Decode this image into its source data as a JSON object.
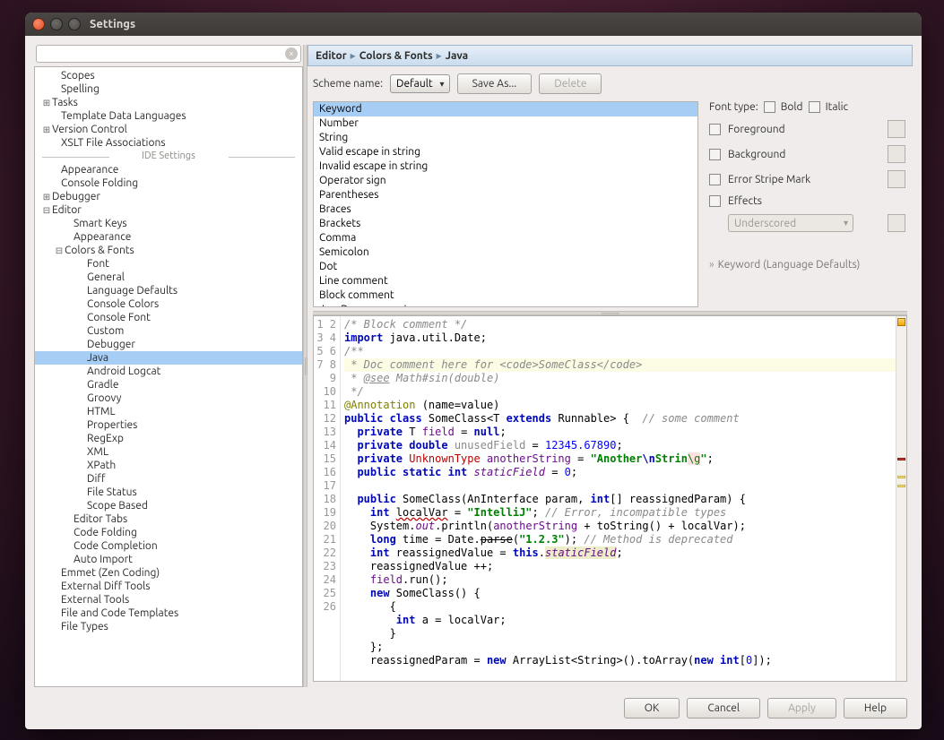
{
  "titlebar": {
    "title": "Settings"
  },
  "search": {
    "placeholder": ""
  },
  "tree_top": [
    {
      "lbl": "Scopes",
      "indent": 18,
      "exp": ""
    },
    {
      "lbl": "Spelling",
      "indent": 18,
      "exp": ""
    },
    {
      "lbl": "Tasks",
      "indent": 8,
      "exp": "⊞"
    },
    {
      "lbl": "Template Data Languages",
      "indent": 18,
      "exp": ""
    },
    {
      "lbl": "Version Control",
      "indent": 8,
      "exp": "⊞"
    },
    {
      "lbl": "XSLT File Associations",
      "indent": 18,
      "exp": ""
    }
  ],
  "tree_sep": "IDE Settings",
  "tree_bottom": [
    {
      "lbl": "Appearance",
      "indent": 18,
      "exp": ""
    },
    {
      "lbl": "Console Folding",
      "indent": 18,
      "exp": ""
    },
    {
      "lbl": "Debugger",
      "indent": 8,
      "exp": "⊞"
    },
    {
      "lbl": "Editor",
      "indent": 8,
      "exp": "⊟"
    },
    {
      "lbl": "Smart Keys",
      "indent": 32,
      "exp": ""
    },
    {
      "lbl": "Appearance",
      "indent": 32,
      "exp": ""
    },
    {
      "lbl": "Colors & Fonts",
      "indent": 22,
      "exp": "⊟"
    },
    {
      "lbl": "Font",
      "indent": 47,
      "exp": ""
    },
    {
      "lbl": "General",
      "indent": 47,
      "exp": ""
    },
    {
      "lbl": "Language Defaults",
      "indent": 47,
      "exp": ""
    },
    {
      "lbl": "Console Colors",
      "indent": 47,
      "exp": ""
    },
    {
      "lbl": "Console Font",
      "indent": 47,
      "exp": ""
    },
    {
      "lbl": "Custom",
      "indent": 47,
      "exp": ""
    },
    {
      "lbl": "Debugger",
      "indent": 47,
      "exp": ""
    },
    {
      "lbl": "Java",
      "indent": 47,
      "exp": "",
      "selected": true
    },
    {
      "lbl": "Android Logcat",
      "indent": 47,
      "exp": ""
    },
    {
      "lbl": "Gradle",
      "indent": 47,
      "exp": ""
    },
    {
      "lbl": "Groovy",
      "indent": 47,
      "exp": ""
    },
    {
      "lbl": "HTML",
      "indent": 47,
      "exp": ""
    },
    {
      "lbl": "Properties",
      "indent": 47,
      "exp": ""
    },
    {
      "lbl": "RegExp",
      "indent": 47,
      "exp": ""
    },
    {
      "lbl": "XML",
      "indent": 47,
      "exp": ""
    },
    {
      "lbl": "XPath",
      "indent": 47,
      "exp": ""
    },
    {
      "lbl": "Diff",
      "indent": 47,
      "exp": ""
    },
    {
      "lbl": "File Status",
      "indent": 47,
      "exp": ""
    },
    {
      "lbl": "Scope Based",
      "indent": 47,
      "exp": ""
    },
    {
      "lbl": "Editor Tabs",
      "indent": 32,
      "exp": ""
    },
    {
      "lbl": "Code Folding",
      "indent": 32,
      "exp": ""
    },
    {
      "lbl": "Code Completion",
      "indent": 32,
      "exp": ""
    },
    {
      "lbl": "Auto Import",
      "indent": 32,
      "exp": ""
    },
    {
      "lbl": "Emmet (Zen Coding)",
      "indent": 18,
      "exp": ""
    },
    {
      "lbl": "External Diff Tools",
      "indent": 18,
      "exp": ""
    },
    {
      "lbl": "External Tools",
      "indent": 18,
      "exp": ""
    },
    {
      "lbl": "File and Code Templates",
      "indent": 18,
      "exp": ""
    },
    {
      "lbl": "File Types",
      "indent": 18,
      "exp": ""
    }
  ],
  "breadcrumb": {
    "a": "Editor",
    "b": "Colors & Fonts",
    "c": "Java"
  },
  "scheme": {
    "label": "Scheme name:",
    "value": "Default",
    "save": "Save As...",
    "delete": "Delete"
  },
  "tokens": [
    "Keyword",
    "Number",
    "String",
    "Valid escape in string",
    "Invalid escape in string",
    "Operator sign",
    "Parentheses",
    "Braces",
    "Brackets",
    "Comma",
    "Semicolon",
    "Dot",
    "Line comment",
    "Block comment",
    "JavaDoc comment"
  ],
  "tokens_selected": 0,
  "fontopts": {
    "fonttype_label": "Font type:",
    "bold": "Bold",
    "italic": "Italic",
    "fg": "Foreground",
    "bg": "Background",
    "stripe": "Error Stripe Mark",
    "effects": "Effects",
    "effects_value": "Underscored",
    "note": "Keyword (Language Defaults)"
  },
  "preview": {
    "lines": 26,
    "l1": "/* Block comment */",
    "l2_a": "import",
    "l2_b": " java.util.Date;",
    "l3": "/**",
    "l4": " * Doc comment here for <code>SomeClass</code>",
    "l5_a": " * ",
    "l5_b": "@see",
    "l5_c": " Math#sin(double)",
    "l6": " */",
    "l7_a": "@Annotation",
    "l7_b": " (name=value)",
    "l8_a": "public class",
    "l8_b": " SomeClass",
    "l8_c": "<T ",
    "l8_d": "extends",
    "l8_e": " Runnable> {",
    "l8_f": "  // some comment",
    "l9_a": "  private",
    "l9_b": " T ",
    "l9_c": "field",
    "l9_d": " = ",
    "l9_e": "null",
    "l9_f": ";",
    "l10_a": "  private double",
    "l10_b": " unusedField",
    "l10_c": " = ",
    "l10_d": "12345.67890",
    "l10_e": ";",
    "l11_a": "  private",
    "l11_b": " UnknownType",
    "l11_c": " anotherString",
    "l11_d": " = ",
    "l11_e": "\"Another",
    "l11_f": "\\n",
    "l11_g": "Strin",
    "l11_h": "\\g",
    "l11_i": "\"",
    "l11_j": ";",
    "l12_a": "  public static int",
    "l12_b": " staticField",
    "l12_c": " = ",
    "l12_d": "0",
    "l12_e": ";",
    "l13": "",
    "l14_a": "  public",
    "l14_b": " SomeClass(AnInterface param, ",
    "l14_c": "int",
    "l14_d": "[] reassignedParam) {",
    "l15_a": "    int ",
    "l15_b": "localVar",
    "l15_c": " = ",
    "l15_d": "\"IntelliJ\"",
    "l15_e": "; ",
    "l15_f": "// Error, incompatible types",
    "l16_a": "    System.",
    "l16_b": "out",
    "l16_c": ".println(",
    "l16_d": "anotherString",
    "l16_e": " + toString() + localVar);",
    "l17_a": "    long",
    "l17_b": " time = Date.",
    "l17_c": "parse",
    "l17_d": "(",
    "l17_e": "\"1.2.3\"",
    "l17_f": "); ",
    "l17_g": "// Method is deprecated",
    "l18_a": "    int",
    "l18_b": " reassignedValue = ",
    "l18_c": "this",
    "l18_d": ".",
    "l18_e": "staticField",
    "l18_f": ";",
    "l19": "    reassignedValue ++;",
    "l20_a": "    field",
    "l20_b": ".run();",
    "l21_a": "    new",
    "l21_b": " SomeClass() {",
    "l22": "       {",
    "l23_a": "        int",
    "l23_b": " a = localVar;",
    "l24": "       }",
    "l25": "    };",
    "l26_a": "    reassignedParam = ",
    "l26_b": "new",
    "l26_c": " ArrayList<String>().toArray(",
    "l26_d": "new int",
    "l26_e": "[",
    "l26_f": "0",
    "l26_g": "]);"
  },
  "buttons": {
    "ok": "OK",
    "cancel": "Cancel",
    "apply": "Apply",
    "help": "Help"
  }
}
